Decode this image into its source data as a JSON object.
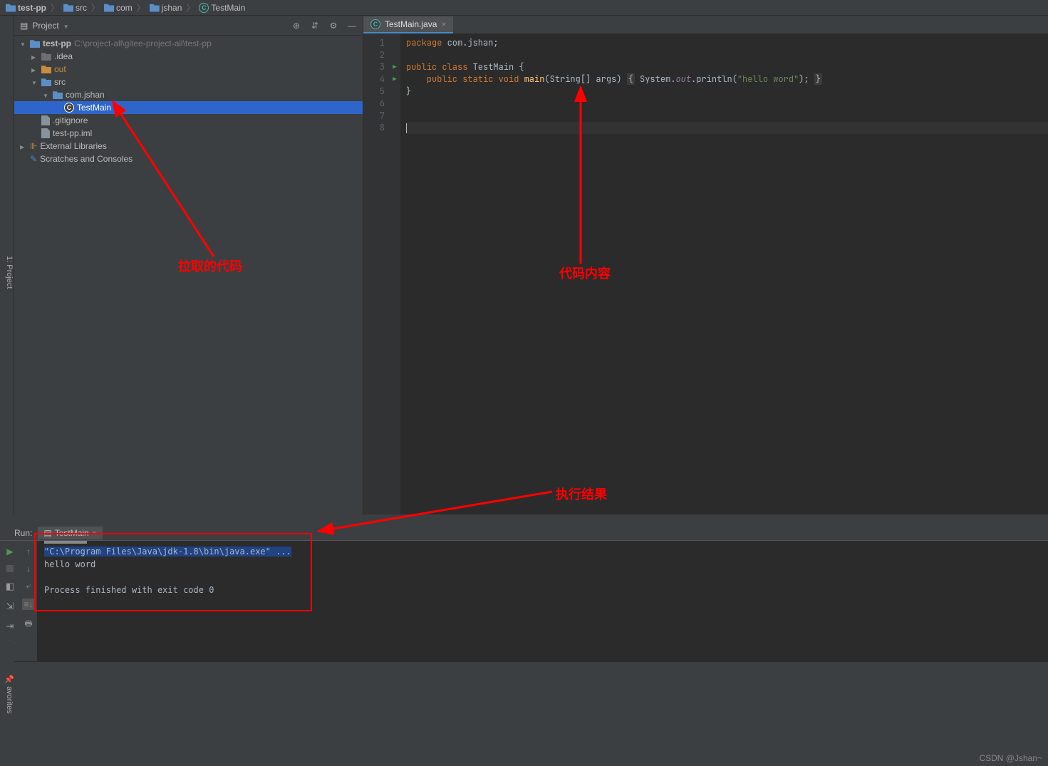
{
  "breadcrumb": {
    "items": [
      {
        "label": "test-pp",
        "icon": "folder-blue",
        "bold": true
      },
      {
        "label": "src",
        "icon": "folder-blue"
      },
      {
        "label": "com",
        "icon": "folder-blue"
      },
      {
        "label": "jshan",
        "icon": "folder-blue"
      },
      {
        "label": "TestMain",
        "icon": "java"
      }
    ]
  },
  "left_gutter_label": "1: Project",
  "project_header": {
    "title": "Project"
  },
  "tree": {
    "root_name": "test-pp",
    "root_path": "C:\\project-all\\gitee-project-all\\test-pp",
    "idea": ".idea",
    "out": "out",
    "src": "src",
    "pkg": "com.jshan",
    "cls": "TestMain",
    "gitignore": ".gitignore",
    "iml": "test-pp.iml",
    "ext_lib": "External Libraries",
    "scratches": "Scratches and Consoles"
  },
  "editor": {
    "tab_name": "TestMain.java",
    "line_count": 8,
    "code": {
      "l1_pkg": "package ",
      "l1_name": "com.jshan;",
      "l3_pub": "public class ",
      "l3_cls": "TestMain",
      "l3_brace": " {",
      "l4_pub": "    public static void ",
      "l4_main": "main",
      "l4_args": "(String[] args) ",
      "l4_brace_open": "{",
      "l4_sys": " System.",
      "l4_out": "out",
      "l4_println": ".println(",
      "l4_str": "\"hello word\"",
      "l4_end": "); ",
      "l4_brace_close": "}",
      "l5": "}"
    }
  },
  "annotations": {
    "left": "拉取的代码",
    "right": "代码内容",
    "bottom": "执行结果"
  },
  "run": {
    "tab_label": "Run:",
    "config_name": "TestMain",
    "output_cmd": "\"C:\\Program Files\\Java\\jdk-1.8\\bin\\java.exe\" ...",
    "output_line1": "hello word",
    "output_exit": "Process finished with exit code 0"
  },
  "watermark": "CSDN @Jshan~",
  "left_bottom_label": "avorites"
}
